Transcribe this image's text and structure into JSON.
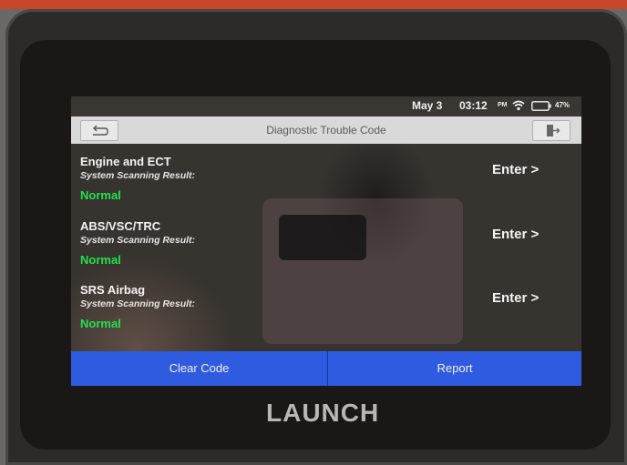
{
  "status_bar": {
    "date": "May 3",
    "time": "03:12",
    "ampm": "PM",
    "battery": "47%"
  },
  "header": {
    "title": "Diagnostic Trouble Code",
    "back_icon": "back-arrow-icon",
    "exit_icon": "exit-icon"
  },
  "systems": [
    {
      "name": "Engine and ECT",
      "result_label": "System Scanning Result:",
      "status": "Normal",
      "enter_label": "Enter >"
    },
    {
      "name": "ABS/VSC/TRC",
      "result_label": "System Scanning Result:",
      "status": "Normal",
      "enter_label": "Enter >"
    },
    {
      "name": "SRS Airbag",
      "result_label": "System Scanning Result:",
      "status": "Normal",
      "enter_label": "Enter >"
    }
  ],
  "footer": {
    "clear_code_label": "Clear Code",
    "report_label": "Report"
  },
  "device": {
    "brand": "LAUNCH"
  },
  "colors": {
    "accent_blue": "#2f5be0",
    "status_normal": "#22e34a",
    "title_bar": "#d9d9d9"
  }
}
